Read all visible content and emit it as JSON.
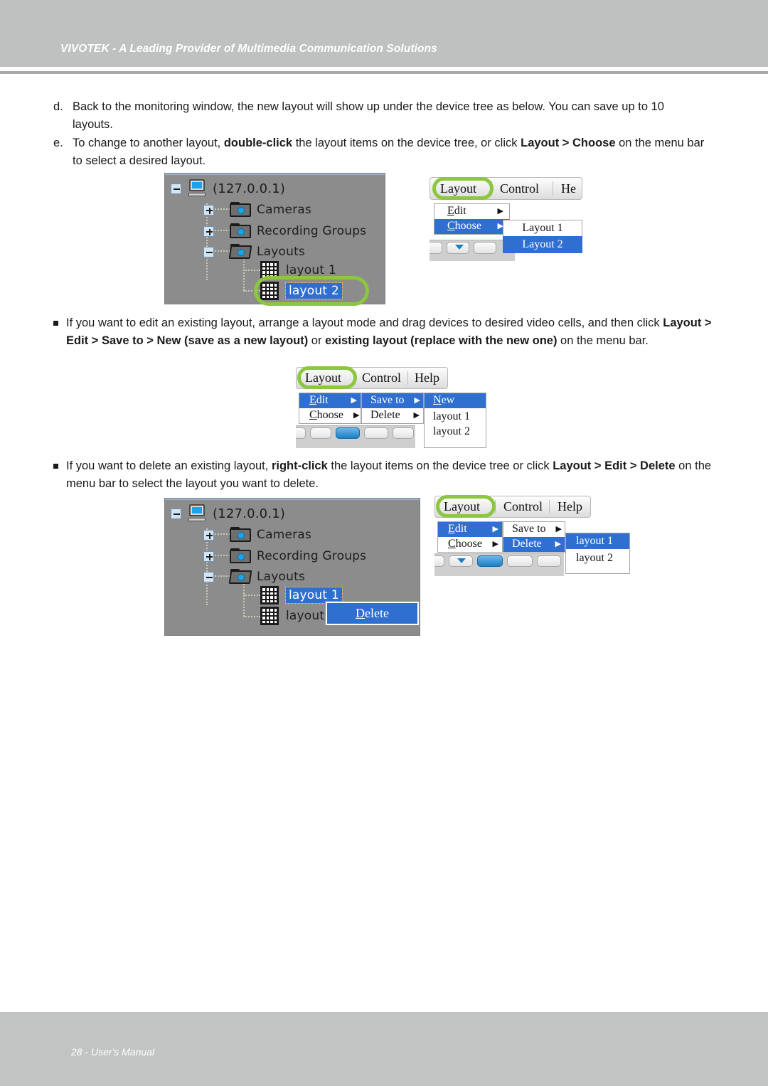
{
  "header": {
    "title": "VIVOTEK - A Leading Provider of Multimedia Communication Solutions"
  },
  "footer": {
    "page_label": "28 - User's Manual"
  },
  "content": {
    "step_d": {
      "marker": "d.",
      "text": "Back to the monitoring window, the new layout will show up under the device tree as below. You can save up to 10 layouts."
    },
    "step_e": {
      "marker": "e.",
      "text_1": "To change to another layout, ",
      "bold_1": "double-click",
      "text_2": " the layout items on the device tree, or click ",
      "bold_2": "Layout > Choose",
      "text_3": " on the menu bar to select a desired layout."
    },
    "bullet_1": {
      "text_1": "If you want to edit an existing layout, arrange a layout mode and drag devices to desired video cells, and then click ",
      "bold_1": "Layout > Edit > Save to > New (save as a new layout)",
      "text_2": " or ",
      "bold_2": "existing layout (replace with the new one)",
      "text_3": " on the menu bar."
    },
    "bullet_2": {
      "text_1": "If you want to delete an existing layout, ",
      "bold_1": "right-click",
      "text_2": " the layout items on the device tree or click ",
      "bold_2": "Layout > Edit > Delete",
      "text_3": " on the menu bar to select the layout you want to delete."
    }
  },
  "tree_choose": {
    "root": "(127.0.0.1)",
    "cameras": "Cameras",
    "recording_groups": "Recording Groups",
    "layouts": "Layouts",
    "layout_1": "layout 1",
    "layout_2": "layout 2",
    "selected": "layout 2",
    "highlight_color": "#8dc63f",
    "selection_color": "#2f6fd0",
    "panel_bg": "#8c8c8c"
  },
  "tree_delete": {
    "root": "(127.0.0.1)",
    "cameras": "Cameras",
    "recording_groups": "Recording Groups",
    "layouts": "Layouts",
    "layout_1": "layout 1",
    "layout_2": "layout",
    "selected": "layout 1",
    "context_menu_item": "Delete",
    "context_menu_item_first": "D",
    "context_menu_item_rest": "elete"
  },
  "menu_choose": {
    "bar": {
      "layout": "Layout",
      "control": "Control",
      "help": "He"
    },
    "items": [
      {
        "label_u": "E",
        "label_rest": "dit",
        "arrow": "▶",
        "highlighted": false
      },
      {
        "label_u": "C",
        "label_rest": "hoose",
        "arrow": "▶",
        "highlighted": true
      }
    ],
    "submenu": [
      {
        "label": "Layout 1",
        "highlighted": false
      },
      {
        "label": "Layout 2",
        "highlighted": true
      }
    ]
  },
  "menu_saveto": {
    "bar": {
      "layout": "Layout",
      "control": "Control",
      "help": "Help"
    },
    "col1": [
      {
        "label_u": "E",
        "label_rest": "dit",
        "arrow": "▶",
        "highlighted": true
      },
      {
        "label_u": "C",
        "label_rest": "hoose",
        "arrow": "▶",
        "highlighted": false
      }
    ],
    "col2": [
      {
        "label": "Save to",
        "arrow": "▶",
        "highlighted": true
      },
      {
        "label": "Delete",
        "arrow": "▶",
        "highlighted": false
      }
    ],
    "col3": [
      {
        "label_u": "N",
        "label_rest": "ew",
        "highlighted": true
      },
      {
        "label": "layout 1",
        "highlighted": false
      },
      {
        "label": "layout 2",
        "highlighted": false
      }
    ]
  },
  "menu_delete": {
    "bar": {
      "layout": "Layout",
      "control": "Control",
      "help": "Help"
    },
    "col1": [
      {
        "label_u": "E",
        "label_rest": "dit",
        "arrow": "▶",
        "highlighted": true
      },
      {
        "label_u": "C",
        "label_rest": "hoose",
        "arrow": "▶",
        "highlighted": false
      }
    ],
    "col2": [
      {
        "label": "Save to",
        "arrow": "▶",
        "highlighted": false
      },
      {
        "label": "Delete",
        "arrow": "▶",
        "highlighted": true
      }
    ],
    "col3": [
      {
        "label": "layout 1",
        "highlighted": true
      },
      {
        "label": "layout 2",
        "highlighted": false
      }
    ]
  }
}
